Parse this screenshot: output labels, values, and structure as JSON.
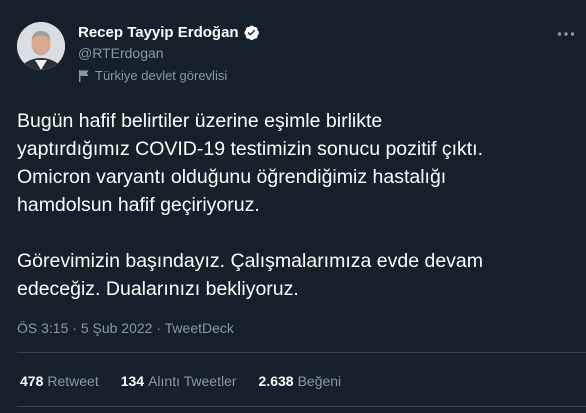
{
  "author": {
    "display_name": "Recep Tayyip Erdoğan",
    "handle": "@RTErdogan",
    "label": "Türkiye devlet görevlisi"
  },
  "tweet": {
    "paragraph1": [
      "Bugün hafif belirtiler üzerine eşimle birlikte",
      "yaptırdığımız COVID-19 testimizin sonucu pozitif çıktı.",
      "Omicron varyantı olduğunu öğrendiğimiz hastalığı",
      "hamdolsun hafif geçiriyoruz."
    ],
    "paragraph2": [
      "Görevimizin başındayız. Çalışmalarımıza evde devam",
      "edeceğiz. Dualarınızı bekliyoruz."
    ]
  },
  "meta": {
    "time": "ÖS 3:15",
    "separator": "·",
    "date": "5 Şub 2022",
    "source": "TweetDeck"
  },
  "stats": {
    "retweets": {
      "count": "478",
      "label": "Retweet"
    },
    "quotes": {
      "count": "134",
      "label": "Alıntı Tweetler"
    },
    "likes": {
      "count": "2.638",
      "label": "Beğeni"
    }
  },
  "icons": {
    "verified": "verified-badge-icon",
    "more": "more-horizontal-icon",
    "label": "flag-icon"
  },
  "colors": {
    "background": "#15202b",
    "text_primary": "#ffffff",
    "text_secondary": "#8b98a5",
    "divider": "#38444d"
  }
}
